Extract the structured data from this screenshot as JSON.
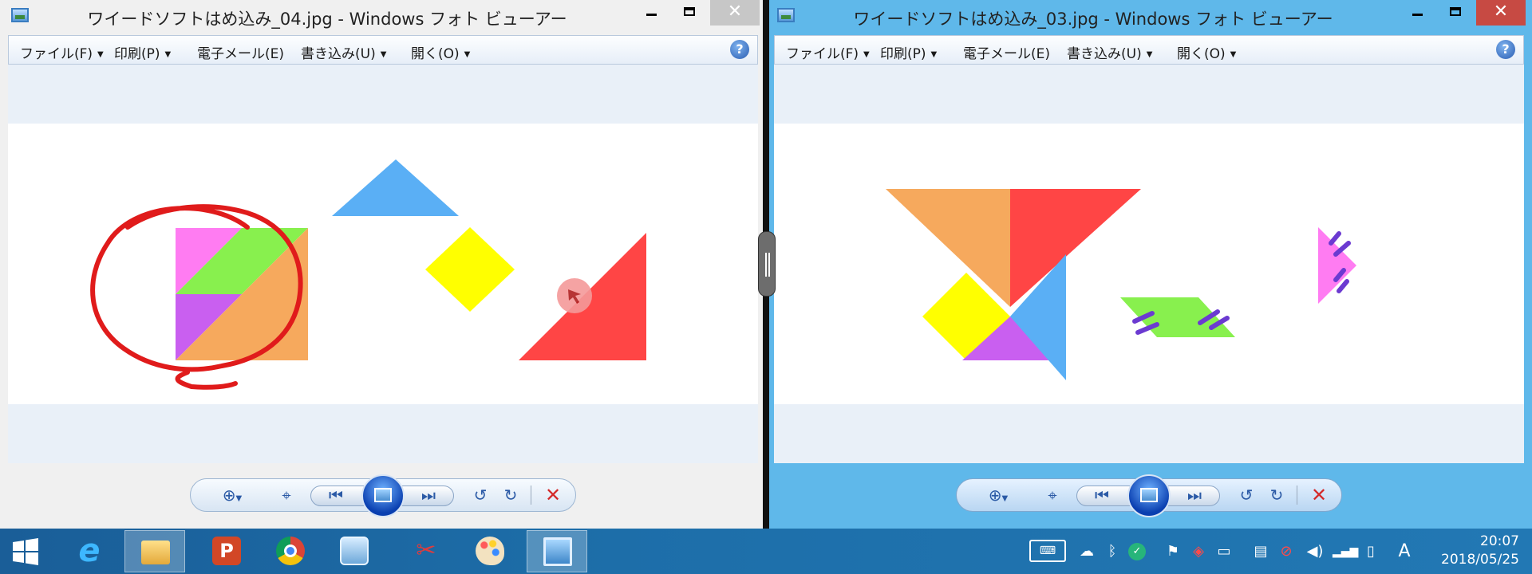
{
  "colors": {
    "pink": "#ff7cf2",
    "green": "#88f04e",
    "purple": "#c95ff0",
    "orange": "#f6a95d",
    "blue": "#5aaff5",
    "yellow": "#ffff00",
    "red": "#ff4545",
    "annotation_red": "#e01b1b",
    "mark_purple": "#6b3ad1"
  },
  "left_window": {
    "title": "ワイードソフトはめ込み_04.jpg - Windows フォト ビューアー",
    "menu": [
      "ファイル(F)",
      "印刷(P)",
      "電子メール(E)",
      "書き込み(U)",
      "開く(O)"
    ],
    "menu_has_dropdown": [
      true,
      true,
      false,
      true,
      true
    ],
    "help": "?"
  },
  "right_window": {
    "title": "ワイードソフトはめ込み_03.jpg - Windows フォト ビューアー",
    "menu": [
      "ファイル(F)",
      "印刷(P)",
      "電子メール(E)",
      "書き込み(U)",
      "開く(O)"
    ],
    "menu_has_dropdown": [
      true,
      true,
      false,
      true,
      true
    ],
    "help": "?"
  },
  "window_controls": {
    "minimize": "minimize-icon",
    "maximize": "maximize-icon",
    "close": "✕"
  },
  "navbar_icons": [
    "zoom-icon",
    "actual-size-icon",
    "previous-icon",
    "slideshow-icon",
    "next-icon",
    "rotate-left-icon",
    "rotate-right-icon",
    "delete-icon"
  ],
  "taskbar": {
    "apps": [
      "internet-explorer-icon",
      "file-explorer-icon",
      "powerpoint-icon",
      "chrome-icon",
      "control-panel-icon",
      "snipping-tool-icon",
      "paint-icon",
      "photo-viewer-icon"
    ],
    "tray": [
      "keyboard-icon",
      "onedrive-icon",
      "bluetooth-icon",
      "app-icon",
      "flag-icon",
      "acrobat-icon",
      "book-icon",
      "network-drive-icon",
      "antivirus-icon",
      "volume-icon",
      "signal-icon",
      "battery-icon"
    ],
    "ime": "A",
    "time": "20:07",
    "date": "2018/05/25"
  }
}
